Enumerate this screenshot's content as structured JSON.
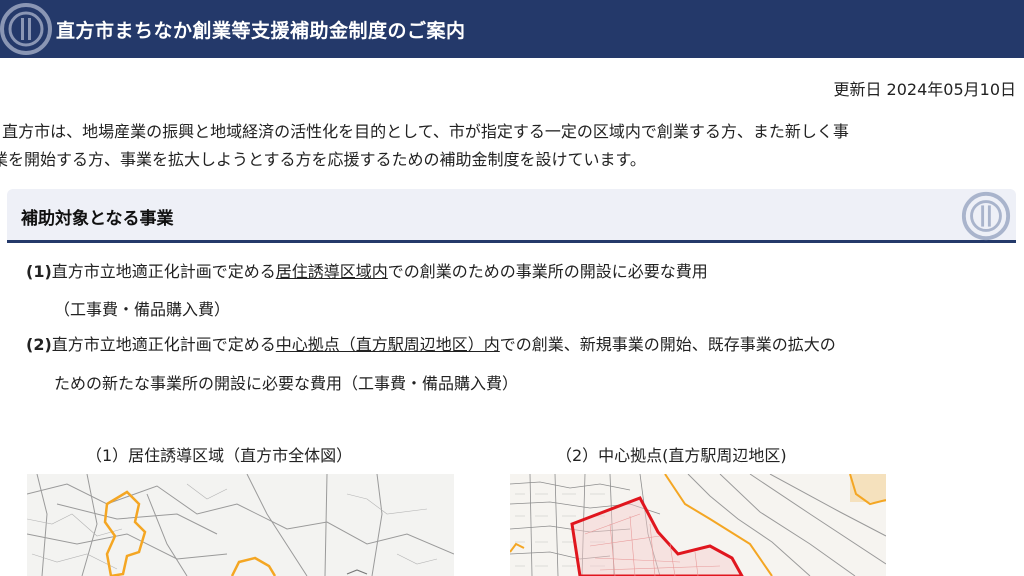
{
  "header": {
    "title": "直方市まちなか創業等支援補助金制度のご案内"
  },
  "updated": "更新日 2024年05月10日",
  "intro": {
    "line1": "直方市は、地場産業の振興と地域経済の活性化を目的として、市が指定する一定の区域内で創業する方、また新しく事",
    "line2": "業を開始する方、事業を拡大しようとする方を応援するための補助金制度を設けています。"
  },
  "section": {
    "title": "補助対象となる事業"
  },
  "items": [
    {
      "num": "(1)",
      "before": "直方市立地適正化計画で定める",
      "link": "居住誘導区域内",
      "after": "での創業のための事業所の開設に必要な費用",
      "sub": "（工事費・備品購入費）"
    },
    {
      "num": "(2)",
      "before": "直方市立地適正化計画で定める",
      "link": "中心拠点（直方駅周辺地区）内",
      "after": "での創業、新規事業の開始、既存事業の拡大の",
      "sub": "ための新たな事業所の開設に必要な費用（工事費・備品購入費）"
    }
  ],
  "maps": [
    {
      "caption": "（1）居住誘導区域（直方市全体図）"
    },
    {
      "caption": "（2）中心拠点(直方駅周辺地区)"
    }
  ],
  "colors": {
    "header_bg": "#24396a",
    "section_bg": "#eef0f7",
    "zone_orange": "#f4a623",
    "zone_red": "#e0161e"
  }
}
